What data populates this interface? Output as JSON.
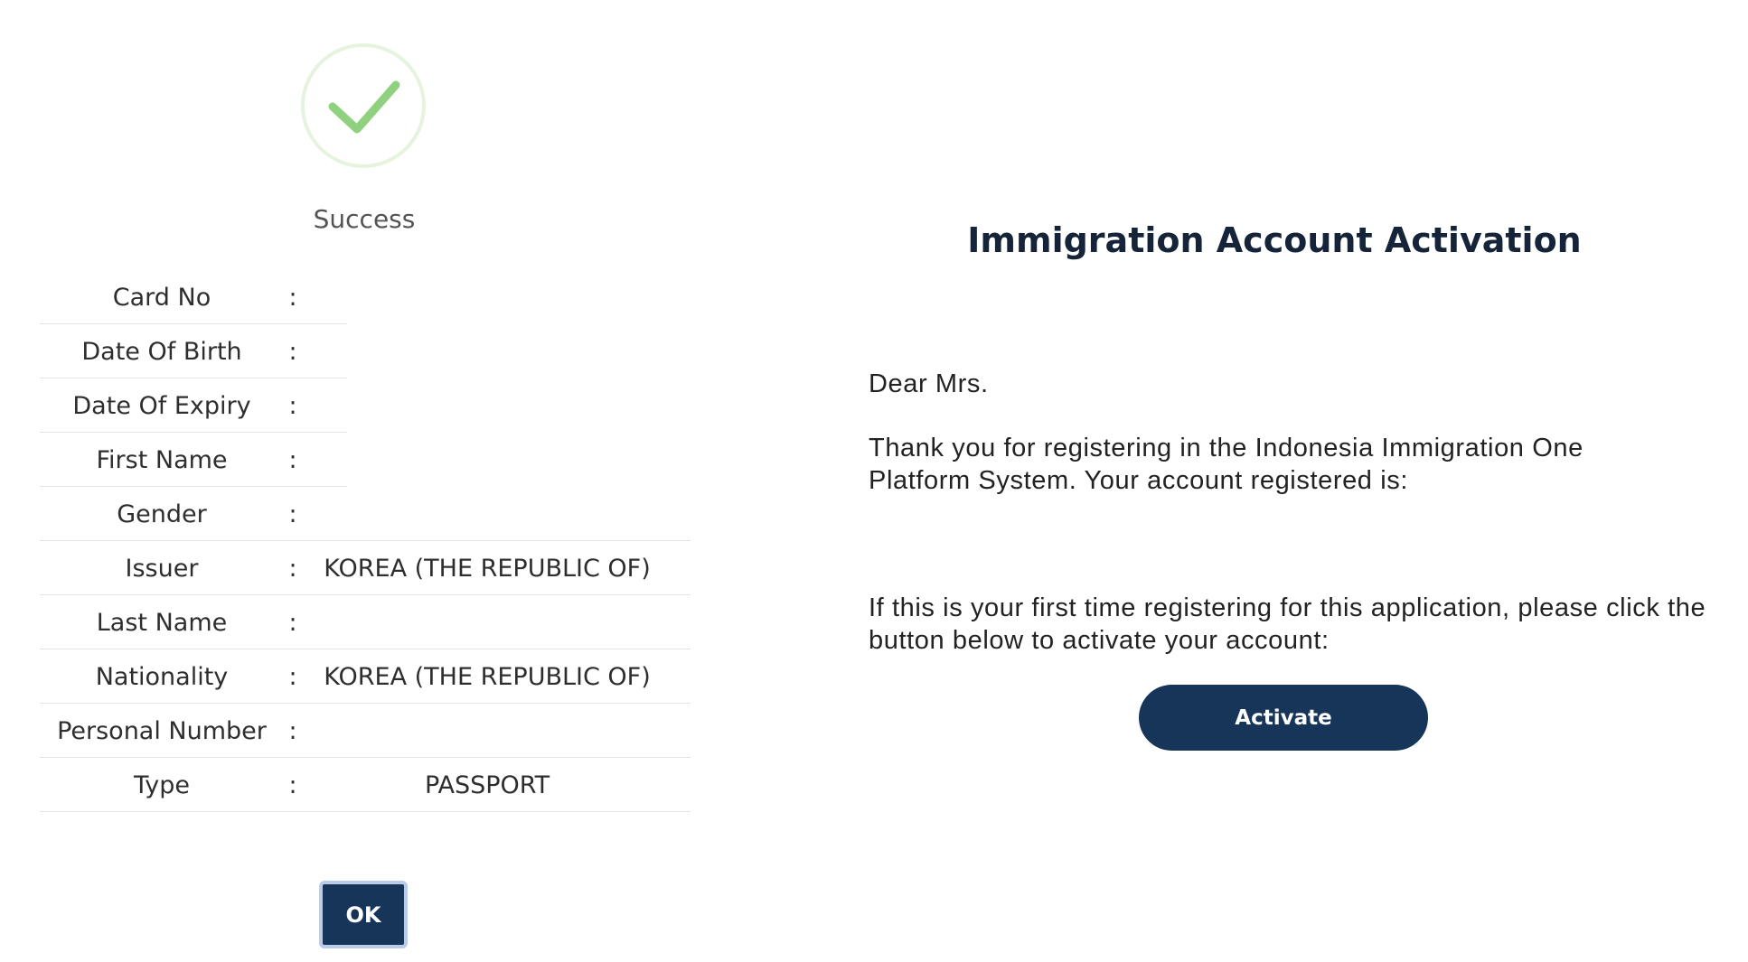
{
  "success_dialog": {
    "icon": "checkmark-circle-icon",
    "title": "Success",
    "rows": [
      {
        "label": "Card No",
        "sep": ":",
        "value": ""
      },
      {
        "label": "Date Of Birth",
        "sep": ":",
        "value": ""
      },
      {
        "label": "Date Of Expiry",
        "sep": ":",
        "value": ""
      },
      {
        "label": "First Name",
        "sep": ":",
        "value": ""
      },
      {
        "label": "Gender",
        "sep": ":",
        "value": ""
      },
      {
        "label": "Issuer",
        "sep": ":",
        "value": "KOREA (THE REPUBLIC OF)"
      },
      {
        "label": "Last Name",
        "sep": ":",
        "value": ""
      },
      {
        "label": "Nationality",
        "sep": ":",
        "value": "KOREA (THE REPUBLIC OF)"
      },
      {
        "label": "Personal Number",
        "sep": ":",
        "value": ""
      },
      {
        "label": "Type",
        "sep": ":",
        "value": "PASSPORT"
      }
    ],
    "ok_label": "OK"
  },
  "activation_email": {
    "title": "Immigration Account Activation",
    "greeting": "Dear Mrs.",
    "thanks_text": "Thank you for registering in the Indonesia Immigration One Platform System. Your account registered is:",
    "first_time_text": "If this is your first time registering for this application, please click the button below to activate your account:",
    "activate_label": "Activate"
  },
  "colors": {
    "primary": "#163559",
    "success_green": "#8fd17f",
    "success_ring": "#e5f3df"
  }
}
